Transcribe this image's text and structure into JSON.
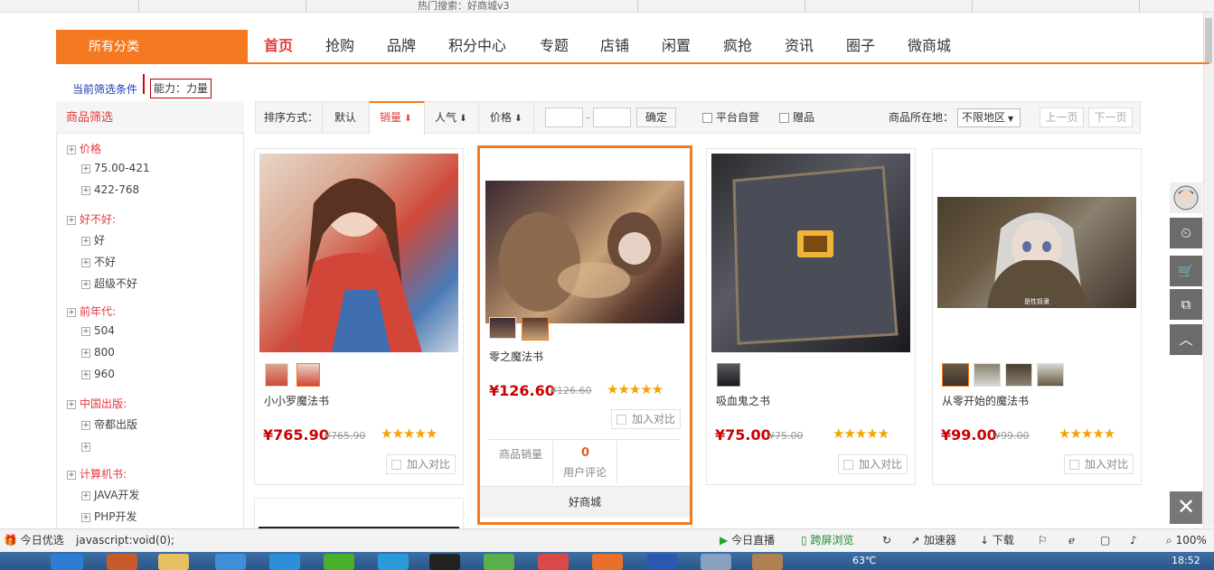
{
  "browser": {
    "top_text": "热门搜索：好商城v3",
    "status_left": "今日优选",
    "status_url": "javascript:void(0);",
    "status_items": [
      "今日直播",
      "跨屏浏览",
      "加速器",
      "下载"
    ],
    "zoom": "100%"
  },
  "nav": {
    "all_categories": "所有分类",
    "items": [
      "首页",
      "抢购",
      "品牌",
      "积分中心",
      "专题",
      "店铺",
      "闲置",
      "疯抢",
      "资讯",
      "圈子",
      "微商城"
    ],
    "active_index": 0
  },
  "breadcrumb": {
    "label": "当前筛选条件",
    "tag": "能力：力量"
  },
  "filter": {
    "title": "商品筛选",
    "groups": [
      {
        "name": "价格",
        "items": [
          "75.00-421",
          "422-768"
        ]
      },
      {
        "name": "好不好:",
        "items": [
          "好",
          "不好",
          "超级不好"
        ]
      },
      {
        "name": "前年代:",
        "items": [
          "504",
          "800",
          "960"
        ]
      },
      {
        "name": "中国出版:",
        "items": [
          "帝都出版",
          ""
        ]
      },
      {
        "name": "计算机书:",
        "items": [
          "JAVA开发",
          "PHP开发"
        ]
      }
    ]
  },
  "sortbar": {
    "label": "排序方式：",
    "options": [
      "默认",
      "销量",
      "人气",
      "价格"
    ],
    "active": "销量",
    "price_sep": "-",
    "confirm": "确定",
    "checkbox_platform": "平台自营",
    "checkbox_gift": "赠品",
    "location_label": "商品所在地：",
    "location_value": "不限地区",
    "prev": "上一页",
    "next": "下一页"
  },
  "products": [
    {
      "name": "小小罗魔法书",
      "price": "¥765.90",
      "old_price": "¥765.90",
      "stars": 5,
      "compare": "加入对比"
    },
    {
      "name": "零之魔法书",
      "price": "¥126.60",
      "old_price": "¥126.60",
      "stars": 5,
      "compare": "加入对比",
      "sales_label": "商品销量",
      "reviews_count": "0",
      "reviews_label": "用户评论",
      "store": "好商城"
    },
    {
      "name": "吸血鬼之书",
      "price": "¥75.00",
      "old_price": "¥75.00",
      "stars": 5,
      "compare": "加入对比"
    },
    {
      "name": "从零开始的魔法书",
      "price": "¥99.00",
      "old_price": "¥99.00",
      "stars": 5,
      "compare": "加入对比"
    }
  ],
  "taskbar": {
    "temp": "63℃",
    "time": "18:52"
  },
  "colors": {
    "accent": "#f47920",
    "price": "#cc0000",
    "star": "#f4a300"
  }
}
